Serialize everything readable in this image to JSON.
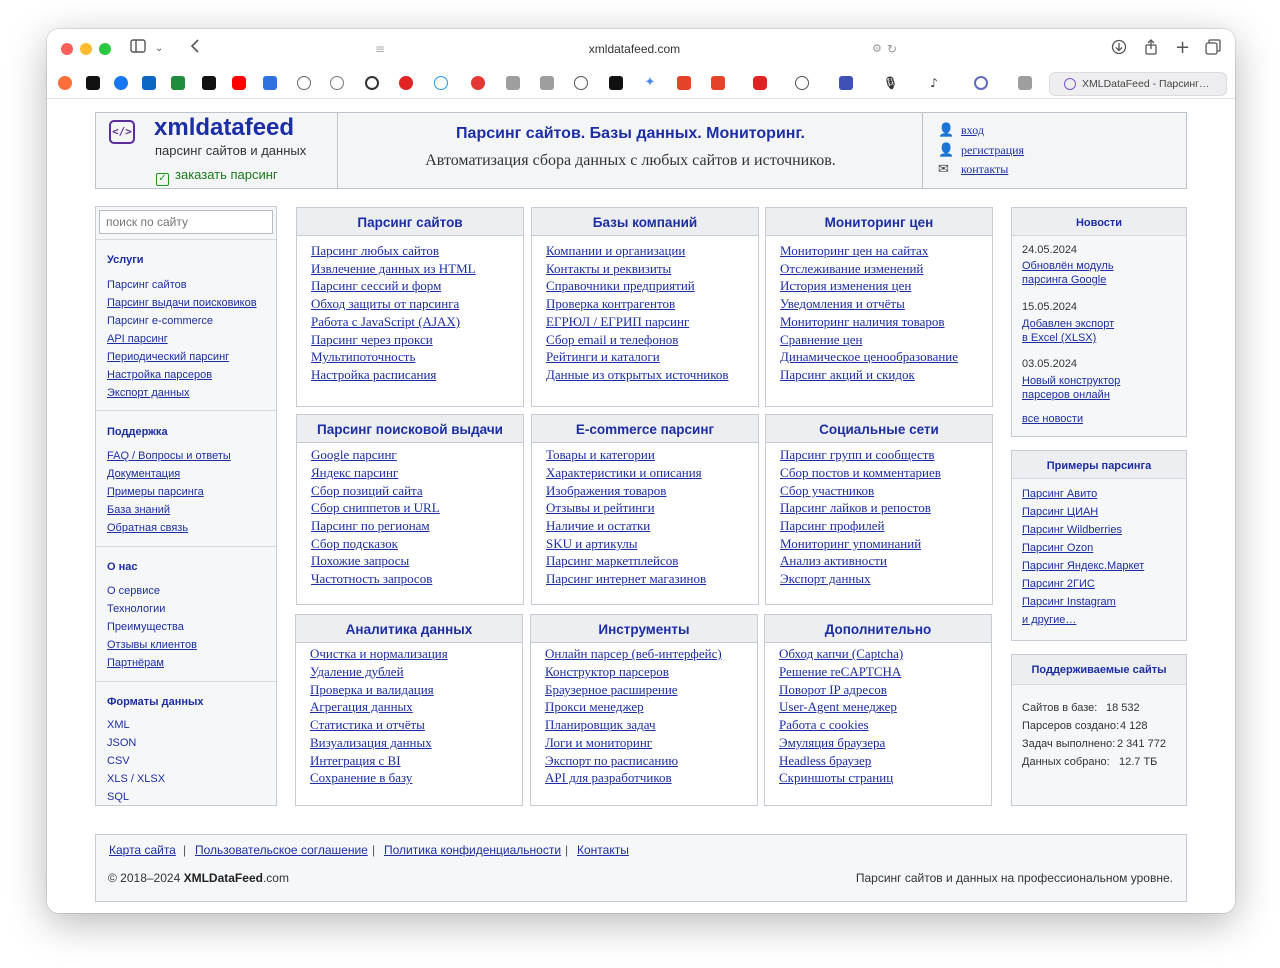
{
  "browser": {
    "url": "xmldatafeed.com",
    "active_tab_title": "XMLDataFeed - Парсинг…"
  },
  "header": {
    "logo_glyph": "</>",
    "site_name": "xmldatafeed",
    "tagline": "парсинг сайтов и данных",
    "order_link": "заказать парсинг",
    "title": "Парсинг сайтов. Базы данных. Мониторинг.",
    "subtitle": "Автоматизация сбора данных с любых сайтов и источников.",
    "account_links": [
      "вход",
      "регистрация",
      "контакты"
    ]
  },
  "sidebar": {
    "search_placeholder": "поиск по сайту",
    "sections": [
      {
        "title": "Услуги",
        "items": [
          "Парсинг сайтов",
          "Парсинг выдачи поисковиков",
          "Парсинг e-commerce",
          "API парсинг",
          "Периодический парсинг",
          "Настройка парсеров",
          "Экспорт данных"
        ]
      },
      {
        "title": "Поддержка",
        "items": [
          "FAQ / Вопросы и ответы",
          "Документация",
          "Примеры парсинга",
          "База знаний",
          "Обратная связь"
        ]
      },
      {
        "title": "О нас",
        "items": [
          "О сервисе",
          "Технологии",
          "Преимущества",
          "Отзывы клиентов",
          "Партнёрам"
        ]
      },
      {
        "title": "Форматы данных",
        "items": [
          "XML",
          "JSON",
          "CSV",
          "XLS / XLSX",
          "SQL"
        ]
      }
    ]
  },
  "panels": [
    {
      "title": "Парсинг сайтов",
      "links": [
        "Парсинг любых сайтов",
        "Извлечение данных из HTML",
        "Парсинг сессий и форм",
        "Обход защиты от парсинга",
        "Работа с JavaScript (AJAX)",
        "Парсинг через прокси",
        "Мультипоточность",
        "Настройка расписания"
      ]
    },
    {
      "title": "Базы компаний",
      "links": [
        "Компании и организации",
        "Контакты и реквизиты",
        "Справочники предприятий",
        "Проверка контрагентов",
        "ЕГРЮЛ / ЕГРИП парсинг",
        "Сбор email и телефонов",
        "Рейтинги и каталоги",
        "Данные из открытых источников"
      ]
    },
    {
      "title": "Мониторинг цен",
      "links": [
        "Мониторинг цен на сайтах",
        "Отслеживание изменений",
        "История изменения цен",
        "Уведомления и отчёты",
        "Мониторинг наличия товаров",
        "Сравнение цен",
        "Динамическое ценообразование",
        "Парсинг акций и скидок"
      ]
    },
    {
      "title": "Парсинг поисковой выдачи",
      "links": [
        "Google парсинг",
        "Яндекс парсинг",
        "Сбор позиций сайта",
        "Сбор сниппетов и URL",
        "Парсинг по регионам",
        "Сбор подсказок",
        "Похожие запросы",
        "Частотность запросов"
      ]
    },
    {
      "title": "E-commerce парсинг",
      "links": [
        "Товары и категории",
        "Характеристики и описания",
        "Изображения товаров",
        "Отзывы и рейтинги",
        "Наличие и остатки",
        "SKU и артикулы",
        "Парсинг маркетплейсов",
        "Парсинг интернет магазинов"
      ]
    },
    {
      "title": "Социальные сети",
      "links": [
        "Парсинг групп и сообществ",
        "Сбор постов и комментариев",
        "Сбор участников",
        "Парсинг лайков и репостов",
        "Парсинг профилей",
        "Мониторинг упоминаний",
        "Анализ активности",
        "Экспорт данных"
      ]
    },
    {
      "title": "Аналитика данных",
      "links": [
        "Очистка и нормализация",
        "Удаление дублей",
        "Проверка и валидация",
        "Агрегация данных",
        "Статистика и отчёты",
        "Визуализация данных",
        "Интеграция с BI",
        "Сохранение в базу"
      ]
    },
    {
      "title": "Инструменты",
      "links": [
        "Онлайн парсер (веб-интерфейс)",
        "Конструктор парсеров",
        "Браузерное расширение",
        "Прокси менеджер",
        "Планировщик задач",
        "Логи и мониторинг",
        "Экспорт по расписанию",
        "API для разработчиков"
      ]
    },
    {
      "title": "Дополнительно",
      "links": [
        "Обход капчи (Captcha)",
        "Решение reCAPTCHA",
        "Поворот IP адресов",
        "User-Agent менеджер",
        "Работа с cookies",
        "Эмуляция браузера",
        "Headless браузер",
        "Скриншоты страниц"
      ]
    }
  ],
  "news": {
    "title": "Новости",
    "items": [
      {
        "date": "24.05.2024",
        "line1": "Обновлён модуль",
        "line2": "парсинга Google"
      },
      {
        "date": "15.05.2024",
        "line1": "Добавлен экспорт",
        "line2": "в Excel (XLSX)"
      },
      {
        "date": "03.05.2024",
        "line1": "Новый конструктор",
        "line2": "парсеров онлайн"
      }
    ],
    "all_link": "все новости"
  },
  "examples": {
    "title": "Примеры парсинга",
    "items": [
      "Парсинг Авито",
      "Парсинг ЦИАН",
      "Парсинг Wildberries",
      "Парсинг Ozon",
      "Парсинг Яндекс.Маркет",
      "Парсинг 2ГИС",
      "Парсинг Instagram",
      "и другие…"
    ]
  },
  "stats": {
    "title": "Поддерживаемые сайты",
    "rows": [
      {
        "label": "Сайтов в базе:",
        "value": "18 532"
      },
      {
        "label": "Парсеров создано:",
        "value": "4 128"
      },
      {
        "label": "Задач выполнено:",
        "value": "2 341 772"
      },
      {
        "label": "Данных собрано:",
        "value": "12.7 ТБ"
      }
    ]
  },
  "footer": {
    "links": [
      "Карта сайта",
      "Пользовательское соглашение",
      "Политика конфиденциальности",
      "Контакты"
    ],
    "separator": "|",
    "copyright_prefix": "© 2018–2024",
    "copyright_brand": "XMLDataFeed",
    "copyright_suffix": ".com",
    "tagline": "Парсинг сайтов и данных на профессиональном уровне."
  }
}
